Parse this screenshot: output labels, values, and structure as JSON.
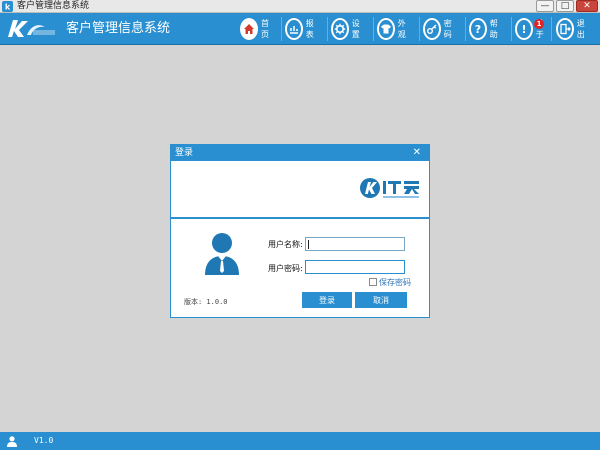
{
  "window": {
    "title": "客户管理信息系统",
    "controls": {
      "minimize": "—",
      "maximize": "□",
      "close": "✕"
    }
  },
  "header": {
    "app_title": "客户管理信息系统",
    "nav": [
      {
        "label": "首页",
        "icon": "home-icon",
        "active": true
      },
      {
        "label": "报表",
        "icon": "report-icon"
      },
      {
        "label": "设置",
        "icon": "gear-icon"
      },
      {
        "label": "外观",
        "icon": "shirt-icon"
      },
      {
        "label": "密码",
        "icon": "key-icon"
      },
      {
        "label": "帮助",
        "icon": "question-icon"
      },
      {
        "label": "关于",
        "icon": "info-icon",
        "badge": "1"
      },
      {
        "label": "退出",
        "icon": "exit-icon"
      }
    ]
  },
  "dialog": {
    "title": "登录",
    "close": "✕",
    "username_label": "用户名称:",
    "username_value": "",
    "password_label": "用户密码:",
    "password_value": "",
    "remember_label": "保存密码",
    "version": "版本: 1.0.0",
    "login_button": "登录",
    "cancel_button": "取消"
  },
  "statusbar": {
    "version": "V1.0"
  },
  "colors": {
    "primary": "#2a8fd0",
    "background": "#d4d4d4",
    "badge": "#e02323"
  }
}
